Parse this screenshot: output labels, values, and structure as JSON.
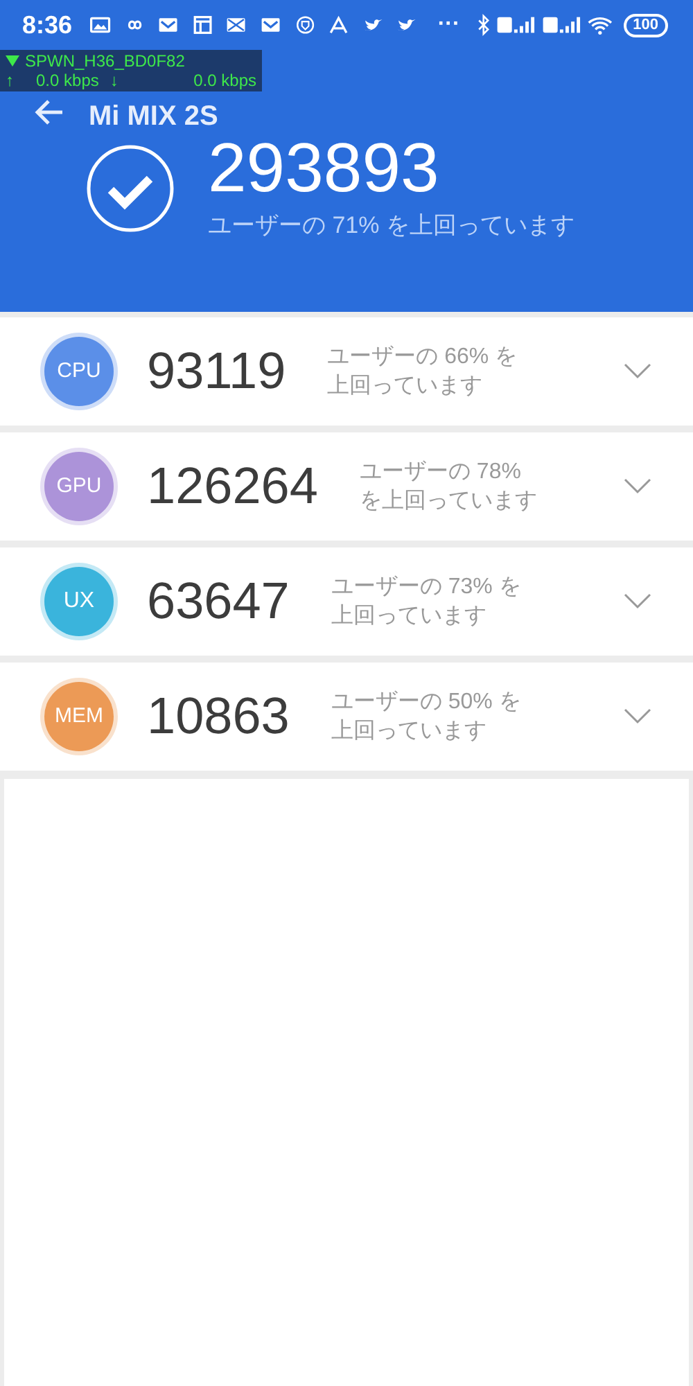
{
  "status_bar": {
    "time": "8:36",
    "more": "···",
    "battery": "100"
  },
  "network_overlay": {
    "ssid": "SPWN_H36_BD0F82",
    "up_arrow": "↑",
    "upload": "0.0 kbps",
    "down_arrow": "↓",
    "download": "0.0 kbps"
  },
  "app_bar": {
    "title": "Mi MIX 2S"
  },
  "total": {
    "score": "293893",
    "note": "ユーザーの 71% を上回っています"
  },
  "categories": [
    {
      "label": "CPU",
      "color": "#5b8fe8",
      "score": "93119",
      "note_lines": [
        "ユーザーの 66% を",
        "上回っています"
      ]
    },
    {
      "label": "GPU",
      "color": "#ac93d9",
      "score": "126264",
      "note_lines": [
        "ユーザーの 78%",
        "を上回っています"
      ]
    },
    {
      "label": "UX",
      "color": "#3ab4dc",
      "score": "63647",
      "note_lines": [
        "ユーザーの 73% を",
        "上回っています"
      ]
    },
    {
      "label": "MEM",
      "color": "#ec9a56",
      "score": "10863",
      "note_lines": [
        "ユーザーの 50% を",
        "上回っています"
      ]
    }
  ]
}
